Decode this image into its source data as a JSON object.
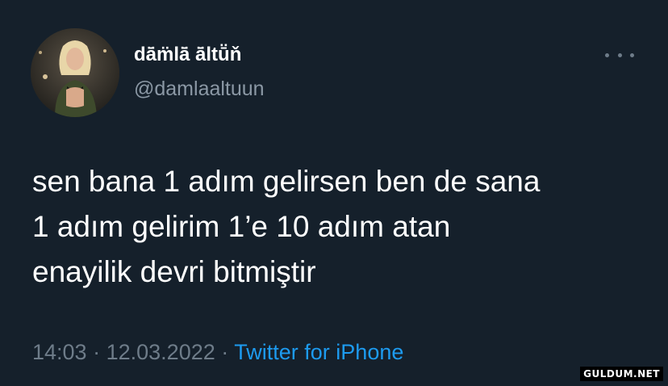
{
  "tweet": {
    "display_name": "dā̈m̈lā̈ ā̈ltṻň",
    "handle": "@damlaaltuun",
    "text": "sen bana 1 adım gelirsen ben de sana\n1 adım gelirim 1’e 10 adım atan\nenayilik devri bitmiştir",
    "time": "14:03",
    "separator": "·",
    "date": "12.03.2022",
    "source": "Twitter for iPhone",
    "more_icon": "more-horizontal-icon"
  },
  "watermark": "GULDUM.NET",
  "colors": {
    "background": "#15202b",
    "text": "#ffffff",
    "muted": "#8b98a5",
    "link": "#1d9bf0"
  }
}
